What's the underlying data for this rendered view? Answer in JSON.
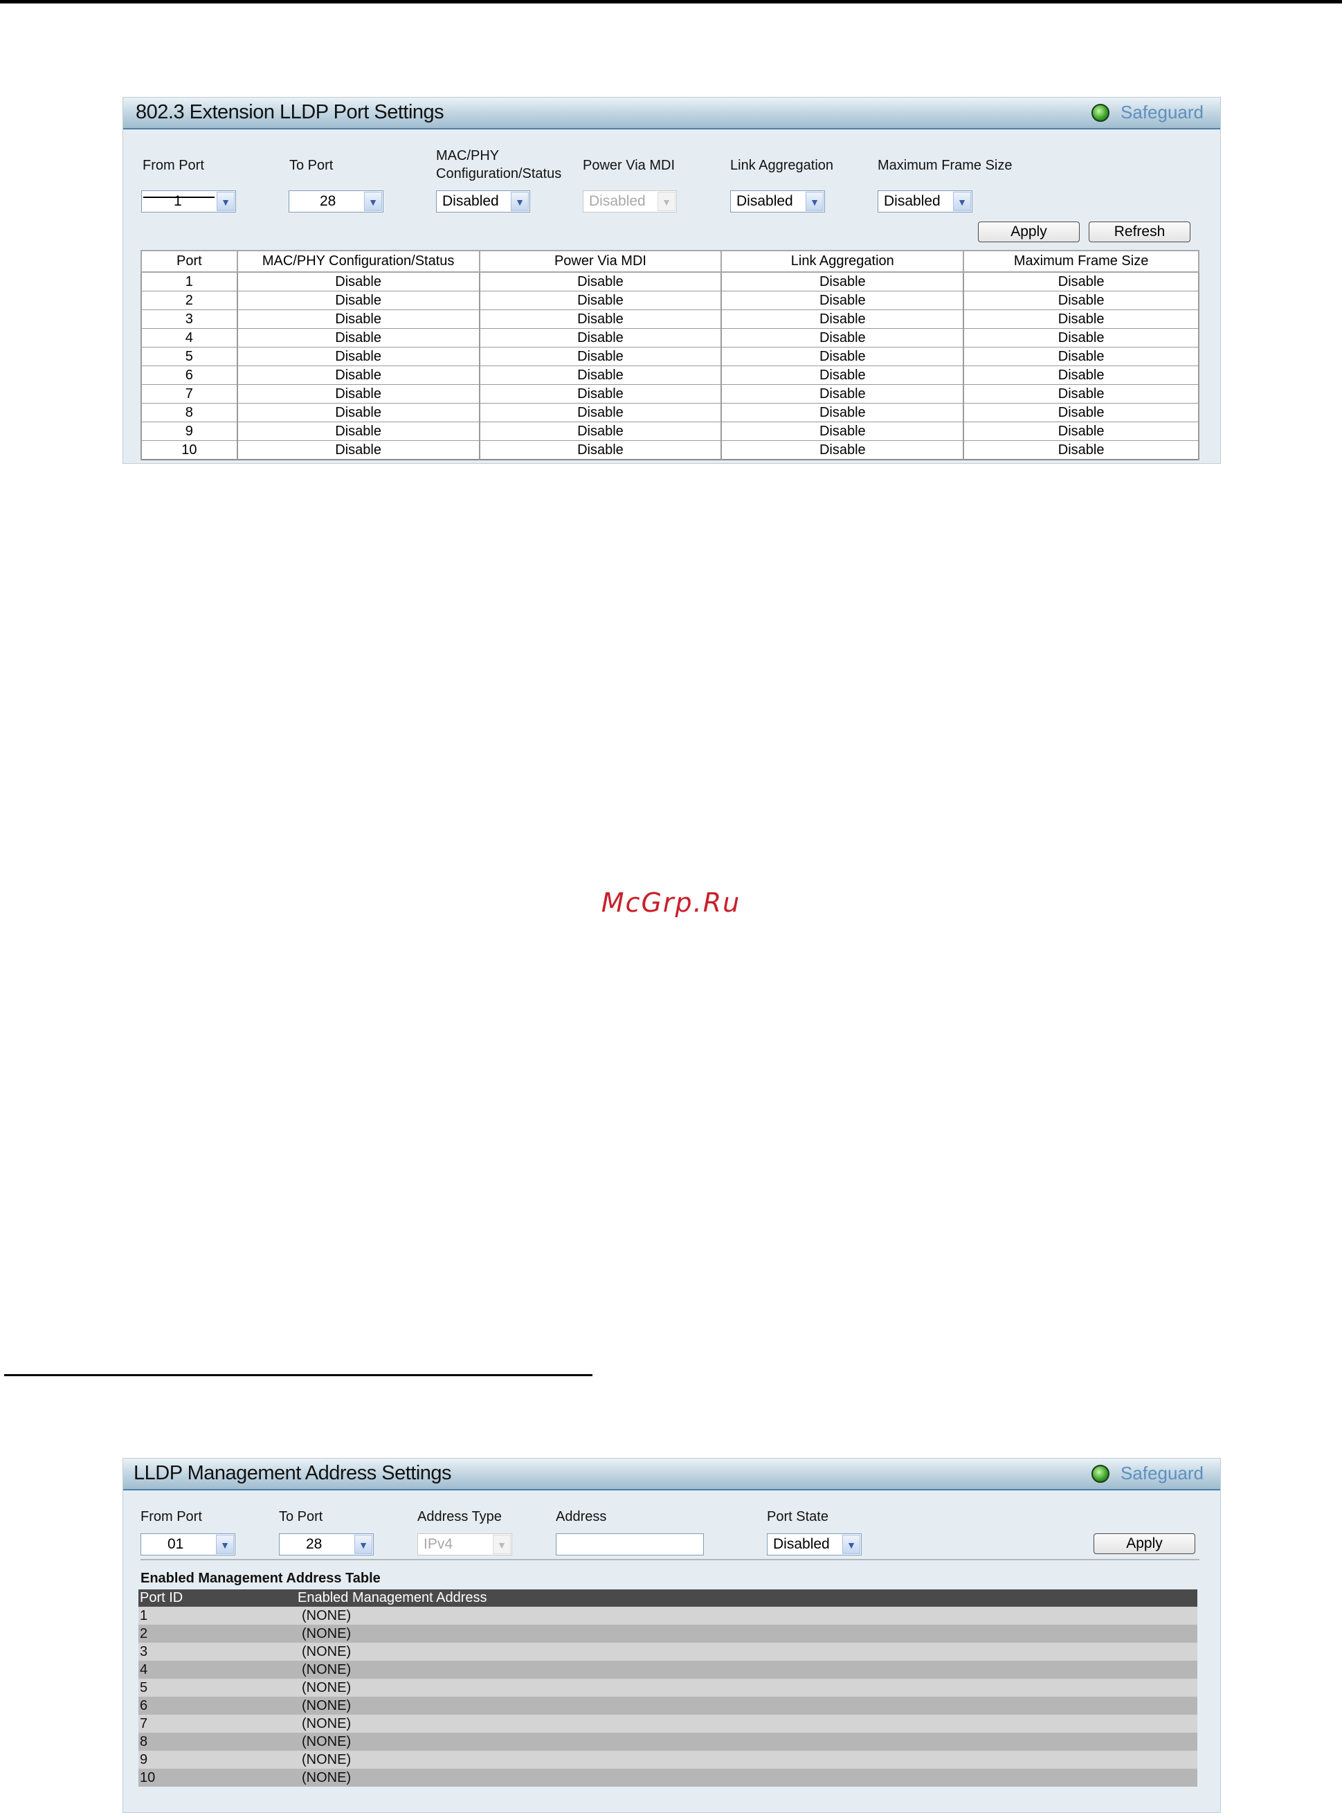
{
  "watermark": "McGrp.Ru",
  "panel1": {
    "title": "802.3 Extension LLDP Port Settings",
    "safeguard": "Safeguard",
    "labels": {
      "from_port": "From Port",
      "to_port": "To Port",
      "mac_phy_1": "MAC/PHY",
      "mac_phy_2": "Configuration/Status",
      "power_via_mdi": "Power Via MDI",
      "link_aggregation": "Link Aggregation",
      "max_frame_size": "Maximum Frame Size"
    },
    "values": {
      "from_port": "1",
      "to_port": "28",
      "mac_phy": "Disabled",
      "power_via_mdi": "Disabled",
      "link_aggregation": "Disabled",
      "max_frame_size": "Disabled"
    },
    "buttons": {
      "apply": "Apply",
      "refresh": "Refresh"
    },
    "table": {
      "headers": [
        "Port",
        "MAC/PHY Configuration/Status",
        "Power Via MDI",
        "Link Aggregation",
        "Maximum Frame Size"
      ],
      "rows": [
        [
          "1",
          "Disable",
          "Disable",
          "Disable",
          "Disable"
        ],
        [
          "2",
          "Disable",
          "Disable",
          "Disable",
          "Disable"
        ],
        [
          "3",
          "Disable",
          "Disable",
          "Disable",
          "Disable"
        ],
        [
          "4",
          "Disable",
          "Disable",
          "Disable",
          "Disable"
        ],
        [
          "5",
          "Disable",
          "Disable",
          "Disable",
          "Disable"
        ],
        [
          "6",
          "Disable",
          "Disable",
          "Disable",
          "Disable"
        ],
        [
          "7",
          "Disable",
          "Disable",
          "Disable",
          "Disable"
        ],
        [
          "8",
          "Disable",
          "Disable",
          "Disable",
          "Disable"
        ],
        [
          "9",
          "Disable",
          "Disable",
          "Disable",
          "Disable"
        ],
        [
          "10",
          "Disable",
          "Disable",
          "Disable",
          "Disable"
        ]
      ]
    }
  },
  "panel2": {
    "title": "LLDP Management Address Settings",
    "safeguard": "Safeguard",
    "labels": {
      "from_port": "From Port",
      "to_port": "To Port",
      "address_type": "Address Type",
      "address": "Address",
      "port_state": "Port State"
    },
    "values": {
      "from_port": "01",
      "to_port": "28",
      "address_type": "IPv4",
      "address": "",
      "port_state": "Disabled"
    },
    "buttons": {
      "apply": "Apply"
    },
    "table_title": "Enabled Management Address Table",
    "table": {
      "headers": [
        "Port ID",
        "Enabled Management Address"
      ],
      "rows": [
        [
          "1",
          "(NONE)"
        ],
        [
          "2",
          "(NONE)"
        ],
        [
          "3",
          "(NONE)"
        ],
        [
          "4",
          "(NONE)"
        ],
        [
          "5",
          "(NONE)"
        ],
        [
          "6",
          "(NONE)"
        ],
        [
          "7",
          "(NONE)"
        ],
        [
          "8",
          "(NONE)"
        ],
        [
          "9",
          "(NONE)"
        ],
        [
          "10",
          "(NONE)"
        ]
      ]
    }
  }
}
